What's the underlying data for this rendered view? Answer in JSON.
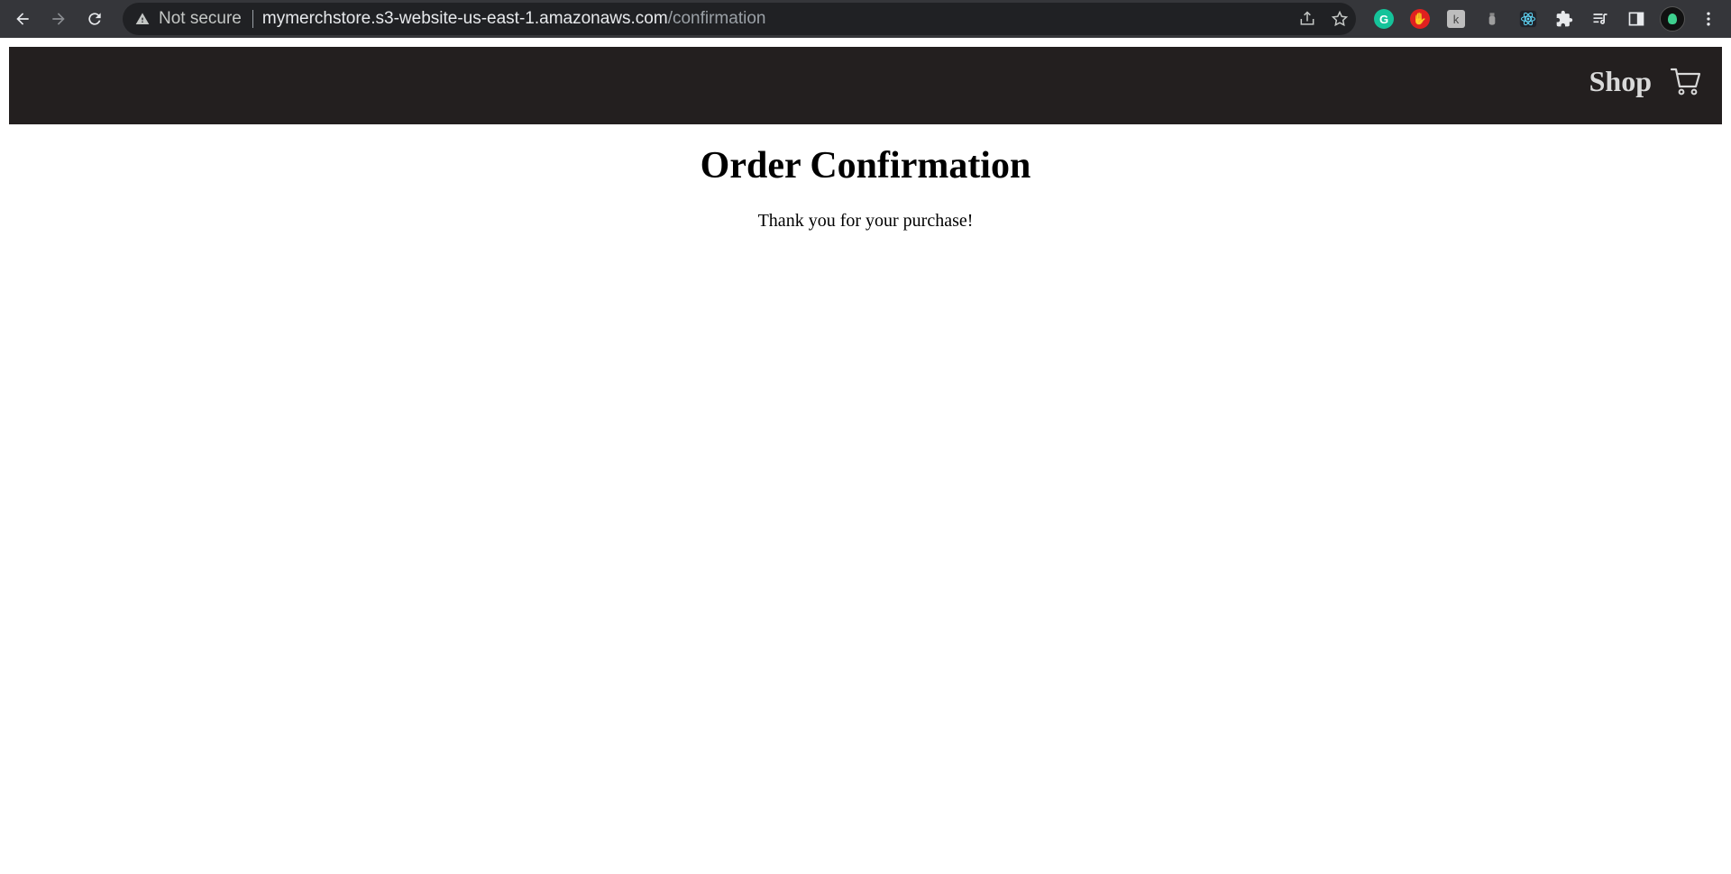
{
  "browser": {
    "security_label": "Not secure",
    "url_host": "mymerchstore.s3-website-us-east-1.amazonaws.com",
    "url_path": "/confirmation",
    "icons": [
      "back-icon",
      "forward-icon",
      "reload-icon",
      "warning-icon",
      "share-icon",
      "bookmark-star-icon",
      "grammarly-icon",
      "adblock-icon",
      "extension-k-icon",
      "extension-bottle-icon",
      "react-devtools-icon",
      "extensions-puzzle-icon",
      "reading-list-icon",
      "side-panel-icon",
      "profile-avatar",
      "menu-kebab-icon"
    ]
  },
  "header": {
    "background": "#231f1f",
    "shop_label": "Shop"
  },
  "main": {
    "title": "Order Confirmation",
    "message": "Thank you for your purchase!"
  },
  "colors": {
    "chrome_bg": "#35363a",
    "omnibox_bg": "#202124",
    "header_bg": "#231f1f",
    "shop_text": "#d9d9d9"
  }
}
